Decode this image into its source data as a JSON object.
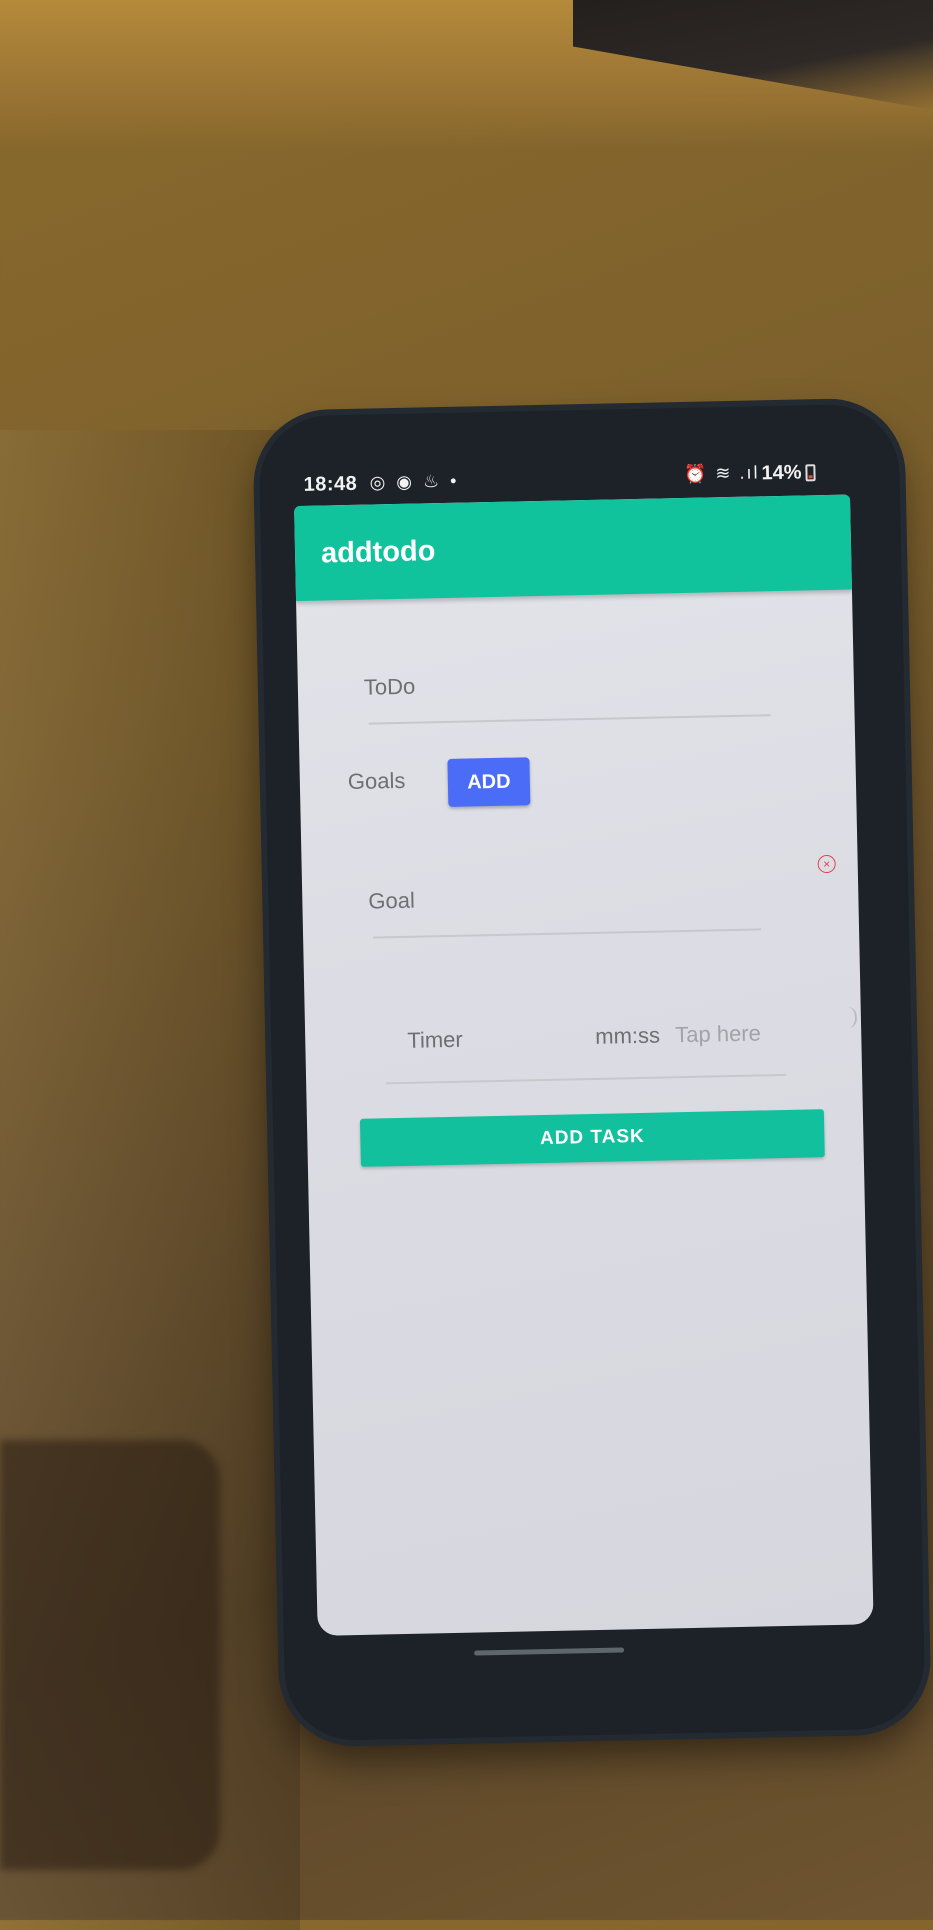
{
  "status_bar": {
    "time": "18:48",
    "left_icons": "◎ ◉ ♨ •",
    "right_icons": "⏰ ≋ .ıl",
    "battery": "14%"
  },
  "app_bar": {
    "title": "addtodo"
  },
  "form": {
    "todo_placeholder": "ToDo",
    "goals_label": "Goals",
    "add_button": "ADD",
    "goal_placeholder": "Goal",
    "clear_glyph": "×",
    "timer_label": "Timer",
    "timer_format": "mm:ss",
    "timer_hint": "Tap here",
    "add_task_button": "ADD TASK"
  },
  "colors": {
    "accent": "#10c39d",
    "add_button": "#4a6cf7",
    "clear_icon": "#e0414b"
  }
}
